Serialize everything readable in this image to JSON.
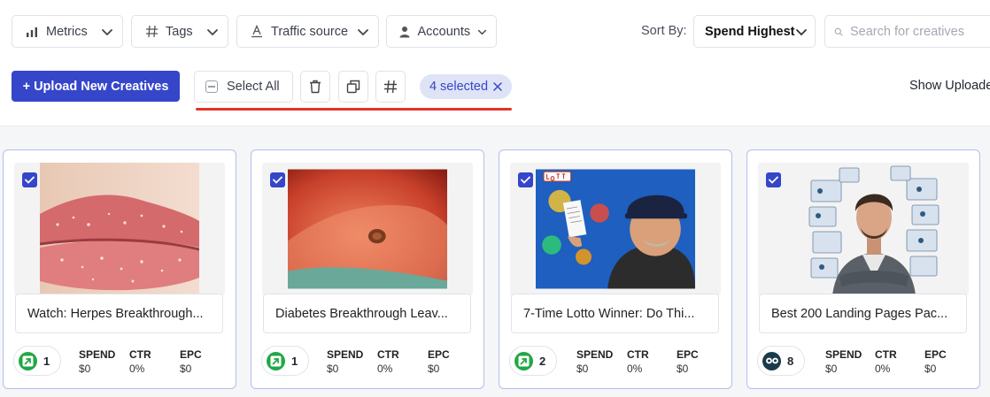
{
  "filters": {
    "metrics": "Metrics",
    "tags": "Tags",
    "traffic_source": "Traffic source",
    "accounts": "Accounts"
  },
  "sort": {
    "label": "Sort By:",
    "value": "Spend Highest"
  },
  "search": {
    "placeholder": "Search for creatives"
  },
  "toolbar": {
    "upload_label": "+ Upload New Creatives",
    "select_all_label": "Select All",
    "selected_label": "4 selected",
    "show_uploaded_label": "Show Uploade"
  },
  "colors": {
    "accent": "#3546c9",
    "chip_bg": "#dfe3f6",
    "underline": "#e5332a",
    "card_border": "#b6bde9",
    "src_green": "#22a745",
    "src_dark": "#1b3a4b"
  },
  "metric_labels": {
    "spend": "SPEND",
    "ctr": "CTR",
    "epc": "EPC"
  },
  "cards": [
    {
      "title": "Watch: Herpes Breakthrough...",
      "count": "1",
      "source_icon": "arrow-up-right-icon",
      "spend": "$0",
      "ctr": "0%",
      "epc": "$0",
      "checked": true
    },
    {
      "title": "Diabetes Breakthrough Leav...",
      "count": "1",
      "source_icon": "arrow-up-right-icon",
      "spend": "$0",
      "ctr": "0%",
      "epc": "$0",
      "checked": true
    },
    {
      "title": "7-Time Lotto Winner: Do Thi...",
      "count": "2",
      "source_icon": "arrow-up-right-icon",
      "spend": "$0",
      "ctr": "0%",
      "epc": "$0",
      "checked": true
    },
    {
      "title": "Best 200 Landing Pages Pac...",
      "count": "8",
      "source_icon": "owl-icon",
      "spend": "$0",
      "ctr": "0%",
      "epc": "$0",
      "checked": true
    }
  ]
}
